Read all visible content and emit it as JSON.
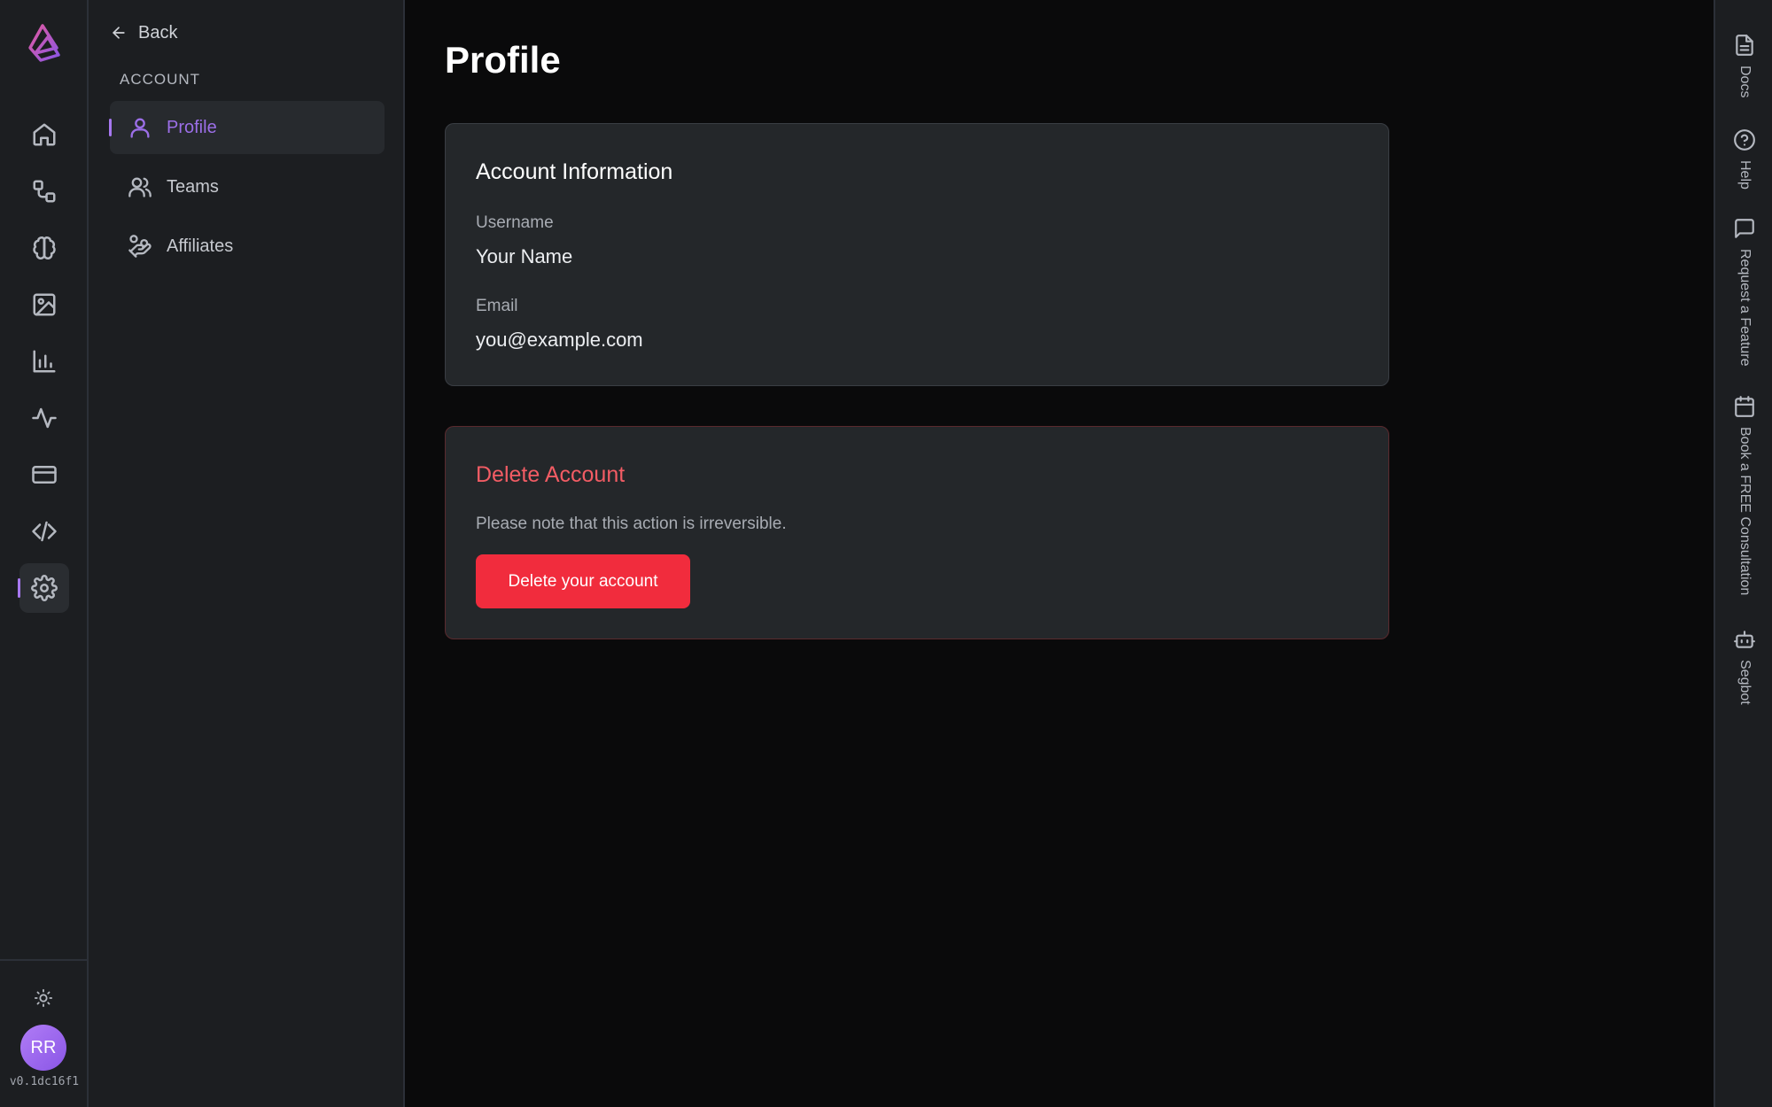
{
  "rail": {
    "icons": [
      "logo-icon",
      "home-icon",
      "workflow-icon",
      "brain-icon",
      "image-icon",
      "bar-chart-icon",
      "activity-icon",
      "credit-card-icon",
      "code-icon",
      "settings-icon"
    ],
    "active": "settings-icon",
    "avatar_initials": "RR",
    "version": "v0.1dc16f1"
  },
  "subnav": {
    "back_label": "Back",
    "section_label": "ACCOUNT",
    "items": [
      {
        "label": "Profile",
        "icon": "user-icon",
        "active": true
      },
      {
        "label": "Teams",
        "icon": "users-icon",
        "active": false
      },
      {
        "label": "Affiliates",
        "icon": "hand-coins-icon",
        "active": false
      }
    ]
  },
  "main": {
    "title": "Profile",
    "account_info": {
      "title": "Account Information",
      "username_label": "Username",
      "username_value": "Your Name",
      "email_label": "Email",
      "email_value": "you@example.com"
    },
    "delete": {
      "title": "Delete Account",
      "note": "Please note that this action is irreversible.",
      "button_label": "Delete your account"
    }
  },
  "right_rail": {
    "items": [
      {
        "label": "Docs",
        "icon": "document-icon"
      },
      {
        "label": "Help",
        "icon": "help-circle-icon"
      },
      {
        "label": "Request a Feature",
        "icon": "message-square-icon"
      },
      {
        "label": "Book a FREE Consultation",
        "icon": "calendar-icon"
      },
      {
        "label": "Segbot",
        "icon": "bot-icon"
      }
    ]
  },
  "colors": {
    "accent": "#a778f0",
    "danger": "#f12c3d",
    "danger_text": "#f25c64",
    "background": "#0a0a0b",
    "panel": "#1c1e21",
    "card": "#24272a"
  }
}
